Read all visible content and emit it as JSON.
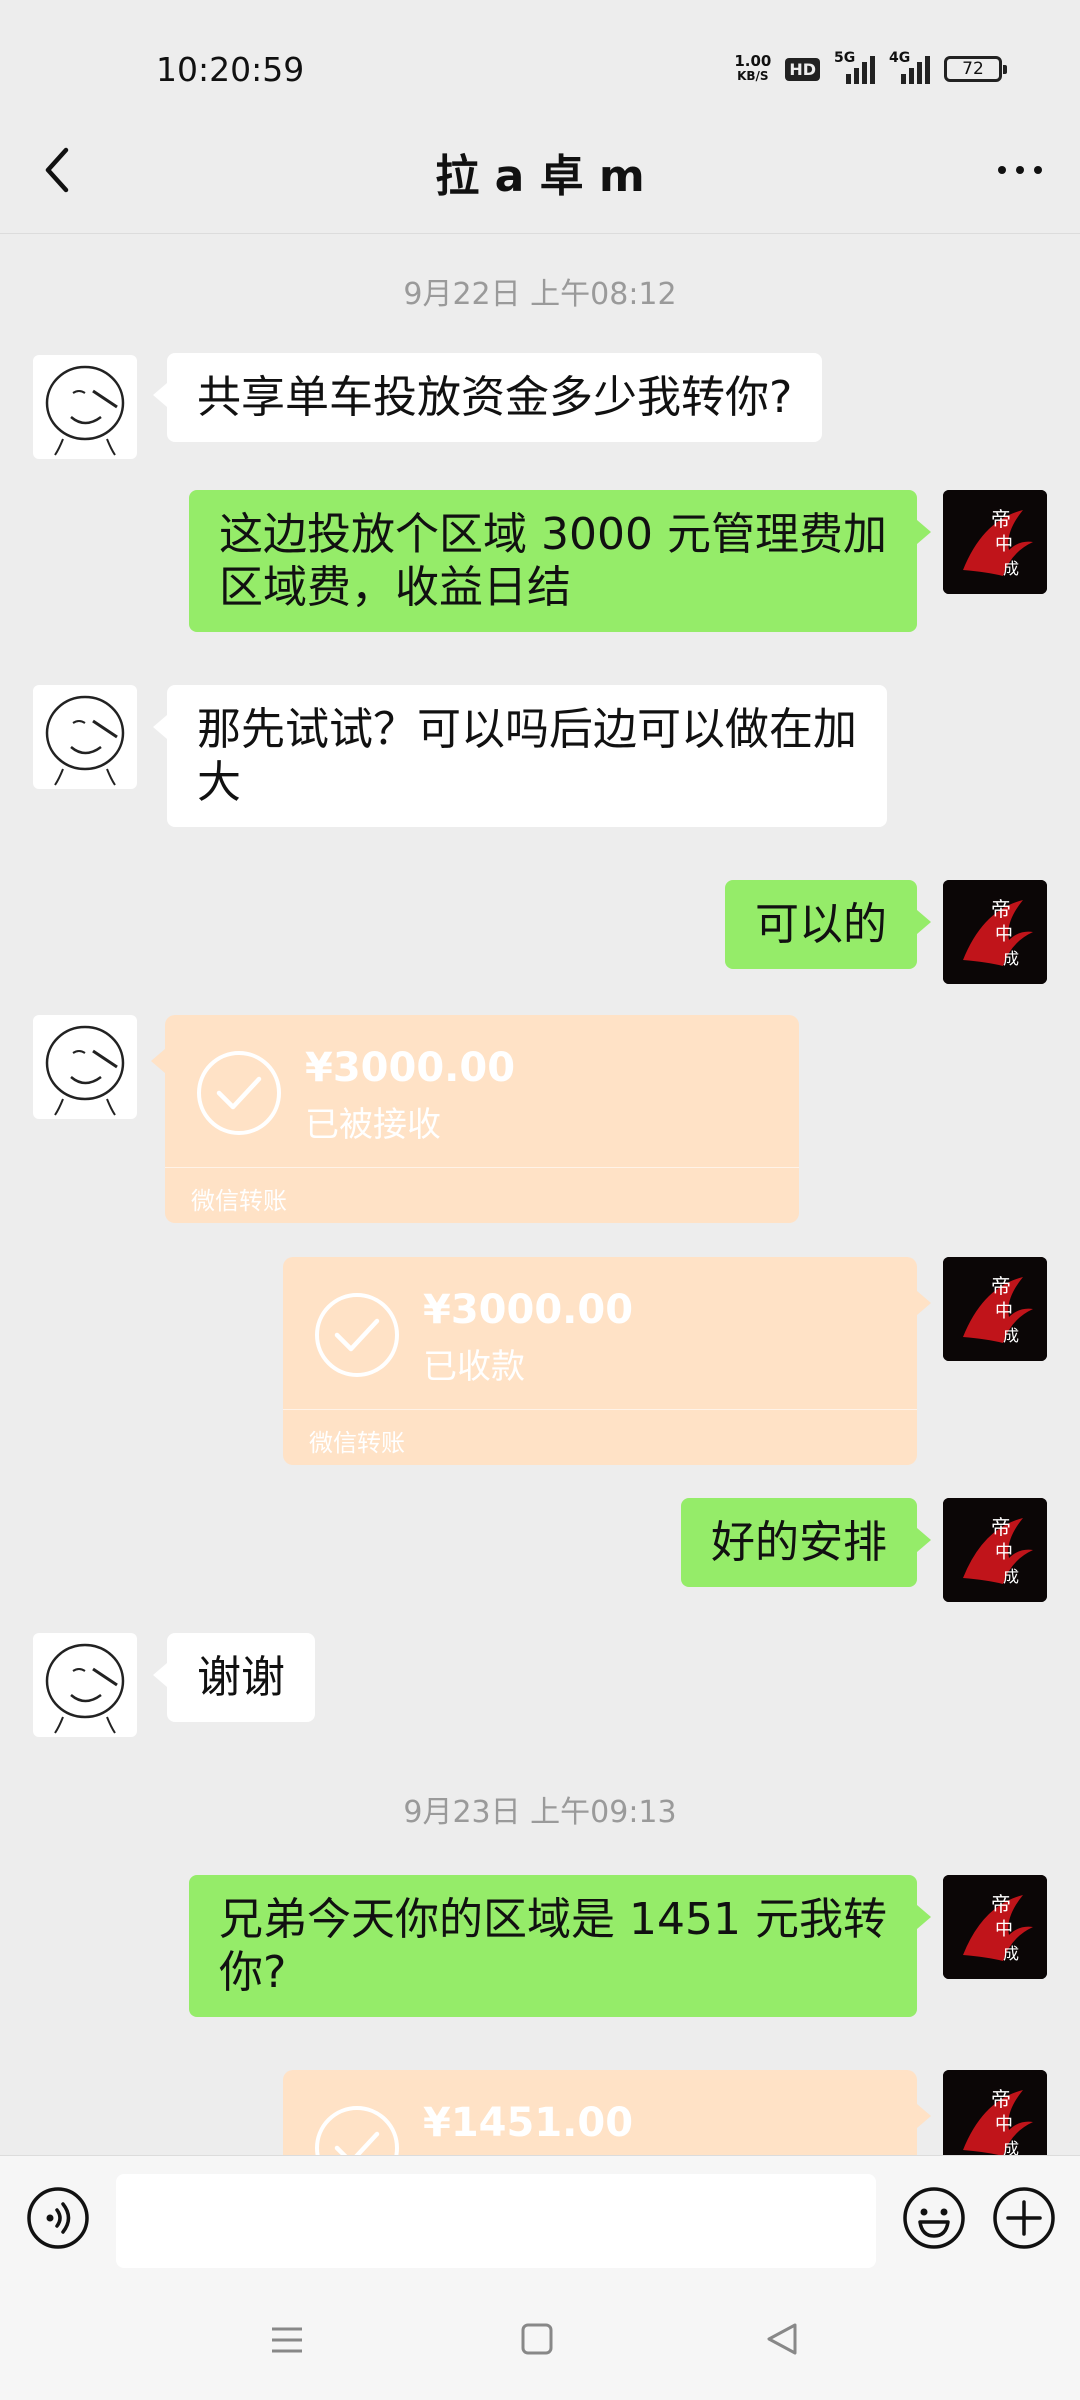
{
  "status_bar": {
    "time": "10:20:59",
    "net_speed_value": "1.00",
    "net_speed_unit": "KB/S",
    "hd_label": "HD",
    "sig1_label": "5G",
    "sig2_label": "4G",
    "battery": "72"
  },
  "header": {
    "title": "拉 a 卓 m",
    "back_icon": "chevron-left-icon",
    "more_icon": "more-horizontal-icon"
  },
  "timestamps": {
    "t1": "9月22日 上午08:12",
    "t2": "9月23日 上午09:13"
  },
  "messages": {
    "m1": "共享单车投放资金多少我转你?",
    "m2_line1": "这边投放个区域 3000 元管理费加",
    "m2_line2": "区域费，收益日结",
    "m3_line1": "那先试试？可以吗后边可以做在加",
    "m3_line2": "大",
    "m4": "可以的",
    "m7": "好的安排",
    "m8": "谢谢",
    "m9_line1": "兄弟今天你的区域是 1451 元我转",
    "m9_line2": "你?"
  },
  "transfers": {
    "tr1": {
      "amount": "¥3000.00",
      "status": "已被接收",
      "label": "微信转账"
    },
    "tr2": {
      "amount": "¥3000.00",
      "status": "已收款",
      "label": "微信转账"
    },
    "tr3": {
      "amount": "¥1451.00"
    }
  },
  "input_bar": {
    "placeholder": "",
    "voice_icon": "voice-icon",
    "emoji_icon": "emoji-icon",
    "plus_icon": "plus-circle-icon"
  },
  "colors": {
    "outgoing_bubble": "#95ec69",
    "incoming_bubble": "#ffffff",
    "transfer_card": "#ffe2c6",
    "background": "#ededed"
  }
}
